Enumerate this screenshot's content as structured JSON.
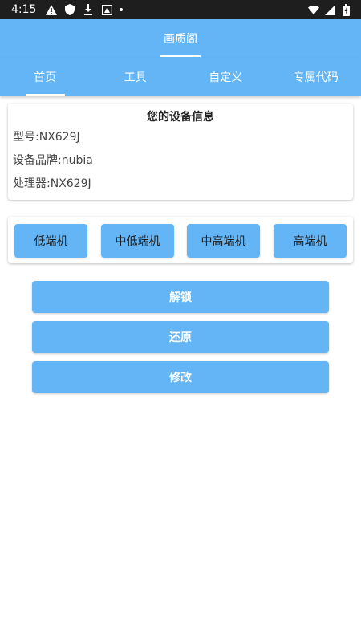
{
  "status_bar": {
    "time": "4:15"
  },
  "app": {
    "title": "画质阁"
  },
  "tabs": [
    {
      "label": "首页",
      "active": true
    },
    {
      "label": "工具",
      "active": false
    },
    {
      "label": "自定义",
      "active": false
    },
    {
      "label": "专属代码",
      "active": false
    }
  ],
  "device_info": {
    "title": "您的设备信息",
    "model": "型号:NX629J",
    "brand": "设备品牌:nubia",
    "processor": "处理器:NX629J"
  },
  "tiers": [
    "低端机",
    "中低端机",
    "中高端机",
    "高端机"
  ],
  "actions": {
    "unlock": "解锁",
    "restore": "还原",
    "modify": "修改"
  },
  "colors": {
    "primary": "#64b5f6",
    "status_bar": "#1e1e1e"
  }
}
